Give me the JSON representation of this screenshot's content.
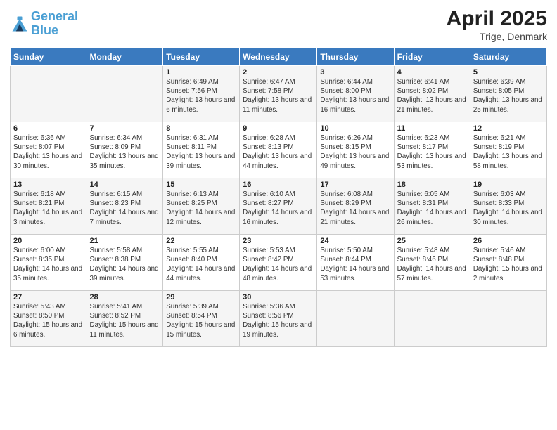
{
  "header": {
    "logo_line1": "General",
    "logo_line2": "Blue",
    "main_title": "April 2025",
    "subtitle": "Trige, Denmark"
  },
  "days_of_week": [
    "Sunday",
    "Monday",
    "Tuesday",
    "Wednesday",
    "Thursday",
    "Friday",
    "Saturday"
  ],
  "weeks": [
    [
      {
        "day": "",
        "info": ""
      },
      {
        "day": "",
        "info": ""
      },
      {
        "day": "1",
        "info": "Sunrise: 6:49 AM\nSunset: 7:56 PM\nDaylight: 13 hours and 6 minutes."
      },
      {
        "day": "2",
        "info": "Sunrise: 6:47 AM\nSunset: 7:58 PM\nDaylight: 13 hours and 11 minutes."
      },
      {
        "day": "3",
        "info": "Sunrise: 6:44 AM\nSunset: 8:00 PM\nDaylight: 13 hours and 16 minutes."
      },
      {
        "day": "4",
        "info": "Sunrise: 6:41 AM\nSunset: 8:02 PM\nDaylight: 13 hours and 21 minutes."
      },
      {
        "day": "5",
        "info": "Sunrise: 6:39 AM\nSunset: 8:05 PM\nDaylight: 13 hours and 25 minutes."
      }
    ],
    [
      {
        "day": "6",
        "info": "Sunrise: 6:36 AM\nSunset: 8:07 PM\nDaylight: 13 hours and 30 minutes."
      },
      {
        "day": "7",
        "info": "Sunrise: 6:34 AM\nSunset: 8:09 PM\nDaylight: 13 hours and 35 minutes."
      },
      {
        "day": "8",
        "info": "Sunrise: 6:31 AM\nSunset: 8:11 PM\nDaylight: 13 hours and 39 minutes."
      },
      {
        "day": "9",
        "info": "Sunrise: 6:28 AM\nSunset: 8:13 PM\nDaylight: 13 hours and 44 minutes."
      },
      {
        "day": "10",
        "info": "Sunrise: 6:26 AM\nSunset: 8:15 PM\nDaylight: 13 hours and 49 minutes."
      },
      {
        "day": "11",
        "info": "Sunrise: 6:23 AM\nSunset: 8:17 PM\nDaylight: 13 hours and 53 minutes."
      },
      {
        "day": "12",
        "info": "Sunrise: 6:21 AM\nSunset: 8:19 PM\nDaylight: 13 hours and 58 minutes."
      }
    ],
    [
      {
        "day": "13",
        "info": "Sunrise: 6:18 AM\nSunset: 8:21 PM\nDaylight: 14 hours and 3 minutes."
      },
      {
        "day": "14",
        "info": "Sunrise: 6:15 AM\nSunset: 8:23 PM\nDaylight: 14 hours and 7 minutes."
      },
      {
        "day": "15",
        "info": "Sunrise: 6:13 AM\nSunset: 8:25 PM\nDaylight: 14 hours and 12 minutes."
      },
      {
        "day": "16",
        "info": "Sunrise: 6:10 AM\nSunset: 8:27 PM\nDaylight: 14 hours and 16 minutes."
      },
      {
        "day": "17",
        "info": "Sunrise: 6:08 AM\nSunset: 8:29 PM\nDaylight: 14 hours and 21 minutes."
      },
      {
        "day": "18",
        "info": "Sunrise: 6:05 AM\nSunset: 8:31 PM\nDaylight: 14 hours and 26 minutes."
      },
      {
        "day": "19",
        "info": "Sunrise: 6:03 AM\nSunset: 8:33 PM\nDaylight: 14 hours and 30 minutes."
      }
    ],
    [
      {
        "day": "20",
        "info": "Sunrise: 6:00 AM\nSunset: 8:35 PM\nDaylight: 14 hours and 35 minutes."
      },
      {
        "day": "21",
        "info": "Sunrise: 5:58 AM\nSunset: 8:38 PM\nDaylight: 14 hours and 39 minutes."
      },
      {
        "day": "22",
        "info": "Sunrise: 5:55 AM\nSunset: 8:40 PM\nDaylight: 14 hours and 44 minutes."
      },
      {
        "day": "23",
        "info": "Sunrise: 5:53 AM\nSunset: 8:42 PM\nDaylight: 14 hours and 48 minutes."
      },
      {
        "day": "24",
        "info": "Sunrise: 5:50 AM\nSunset: 8:44 PM\nDaylight: 14 hours and 53 minutes."
      },
      {
        "day": "25",
        "info": "Sunrise: 5:48 AM\nSunset: 8:46 PM\nDaylight: 14 hours and 57 minutes."
      },
      {
        "day": "26",
        "info": "Sunrise: 5:46 AM\nSunset: 8:48 PM\nDaylight: 15 hours and 2 minutes."
      }
    ],
    [
      {
        "day": "27",
        "info": "Sunrise: 5:43 AM\nSunset: 8:50 PM\nDaylight: 15 hours and 6 minutes."
      },
      {
        "day": "28",
        "info": "Sunrise: 5:41 AM\nSunset: 8:52 PM\nDaylight: 15 hours and 11 minutes."
      },
      {
        "day": "29",
        "info": "Sunrise: 5:39 AM\nSunset: 8:54 PM\nDaylight: 15 hours and 15 minutes."
      },
      {
        "day": "30",
        "info": "Sunrise: 5:36 AM\nSunset: 8:56 PM\nDaylight: 15 hours and 19 minutes."
      },
      {
        "day": "",
        "info": ""
      },
      {
        "day": "",
        "info": ""
      },
      {
        "day": "",
        "info": ""
      }
    ]
  ]
}
